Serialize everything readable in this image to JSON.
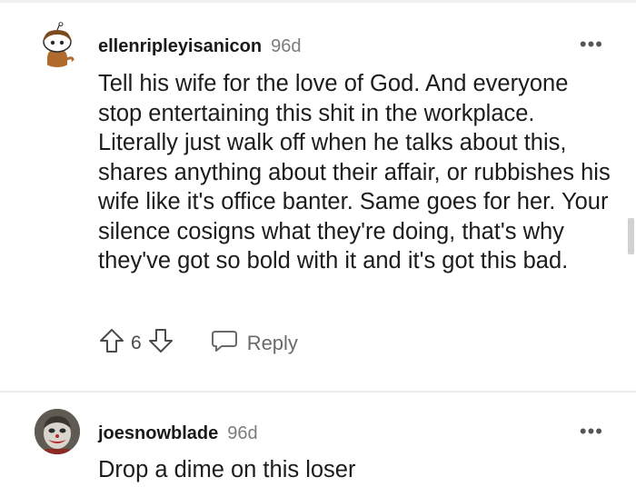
{
  "comments": [
    {
      "username": "ellenripleyisanicon",
      "age": "96d",
      "more_label": "•••",
      "body": "Tell his wife for the love of God. And everyone stop entertaining this shit in the workplace. Literally just walk off when he talks about this, shares anything about their affair, or rubbishes his wife like it's office banter. Same goes for her. Your silence cosigns what they're doing, that's why they've got so bold with it and it's got this bad.",
      "votes": "6",
      "reply_label": "Reply",
      "avatar_icon": "snoo-avatar-icon"
    },
    {
      "username": "joesnowblade",
      "age": "96d",
      "more_label": "•••",
      "body": "Drop a dime on this loser",
      "avatar_icon": "clown-avatar-icon"
    }
  ],
  "colors": {
    "text": "#1c1c1c",
    "muted": "#7c7c7c",
    "divider": "#e9ebed"
  }
}
